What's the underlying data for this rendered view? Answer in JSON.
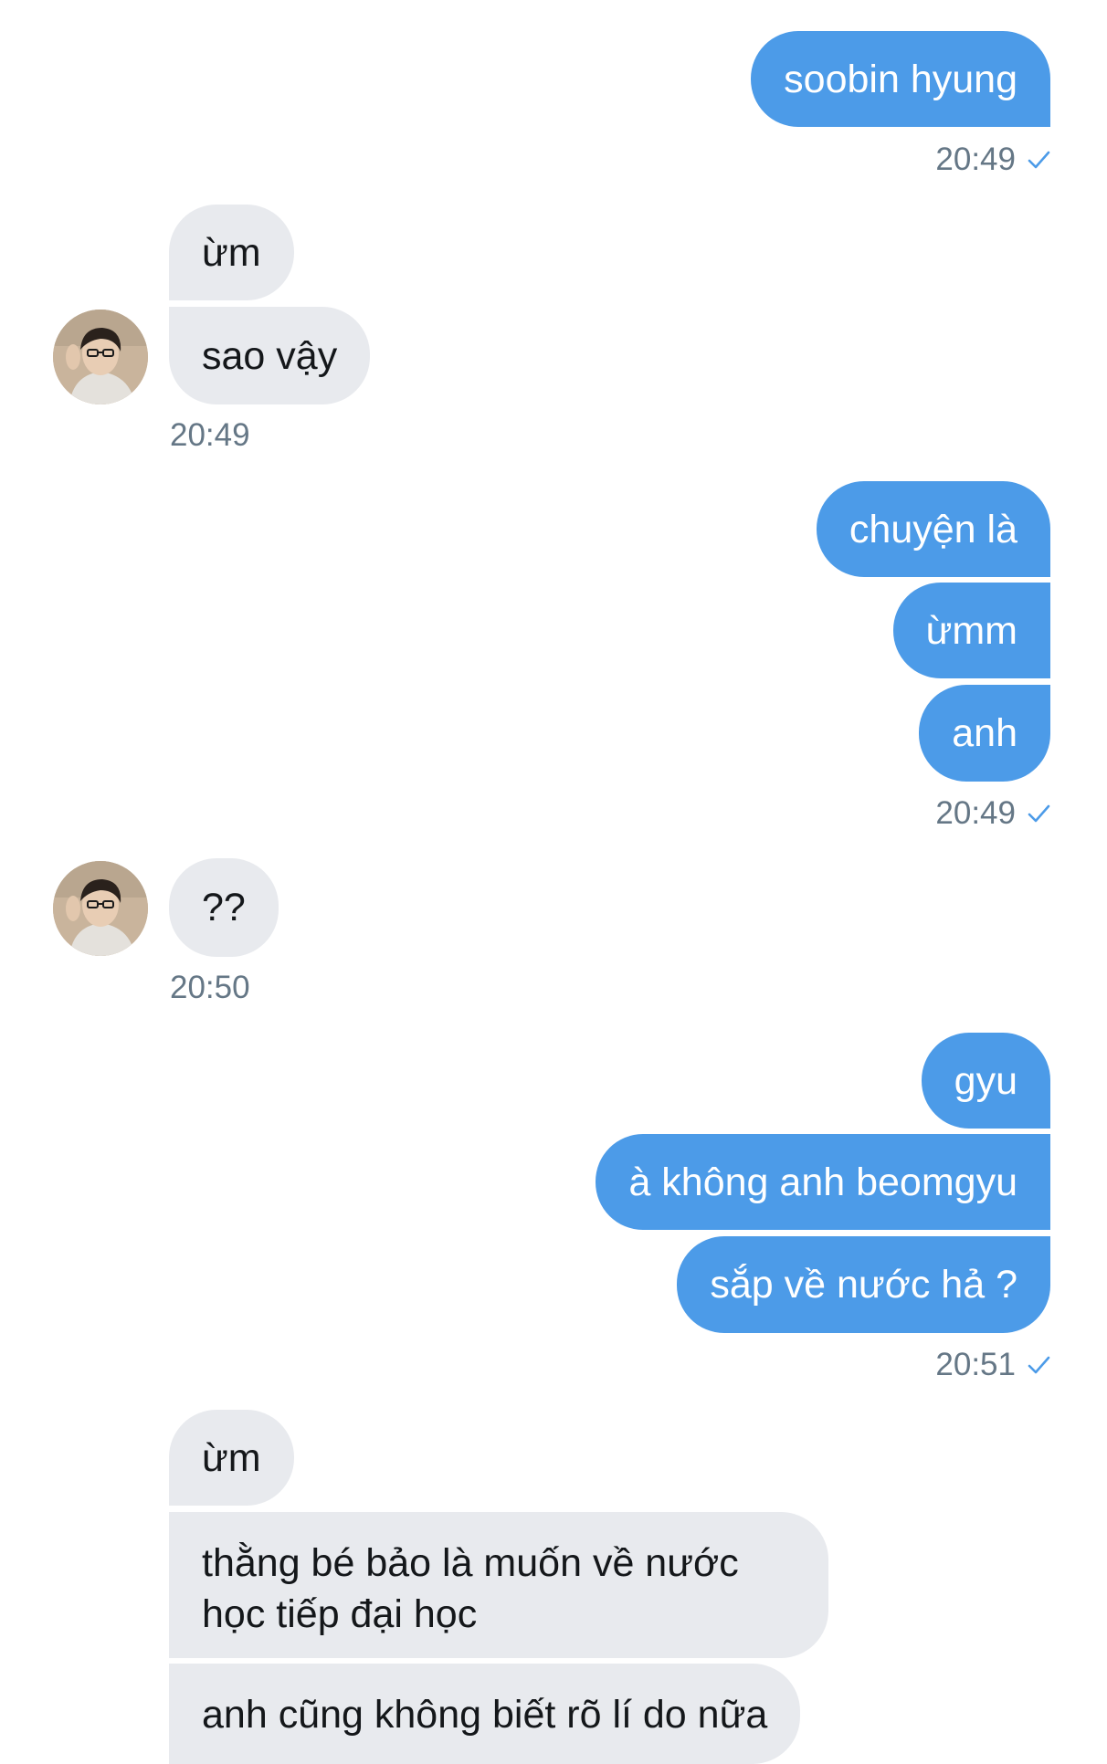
{
  "colors": {
    "outgoing_bubble": "#4c9be8",
    "incoming_bubble": "#e8eaee",
    "timestamp": "#657786",
    "read_check": "#4c9be8"
  },
  "messages": {
    "g1": {
      "m1": "soobin hyung",
      "time": "20:49"
    },
    "g2": {
      "m1": "ừm",
      "m2": "sao vậy",
      "time": "20:49"
    },
    "g3": {
      "m1": "chuyện là",
      "m2": "ừmm",
      "m3": "anh",
      "time": "20:49"
    },
    "g4": {
      "m1": "??",
      "time": "20:50"
    },
    "g5": {
      "m1": "gyu",
      "m2": "à không anh beomgyu",
      "m3": "sắp về nước hả ?",
      "time": "20:51"
    },
    "g6": {
      "m1": "ừm",
      "m2": "thằng bé bảo là muốn về nước học tiếp đại học",
      "m3": "anh cũng không biết rõ lí do nữa"
    }
  },
  "icons": {
    "read_receipt": "check-icon",
    "contact_avatar": "avatar"
  }
}
